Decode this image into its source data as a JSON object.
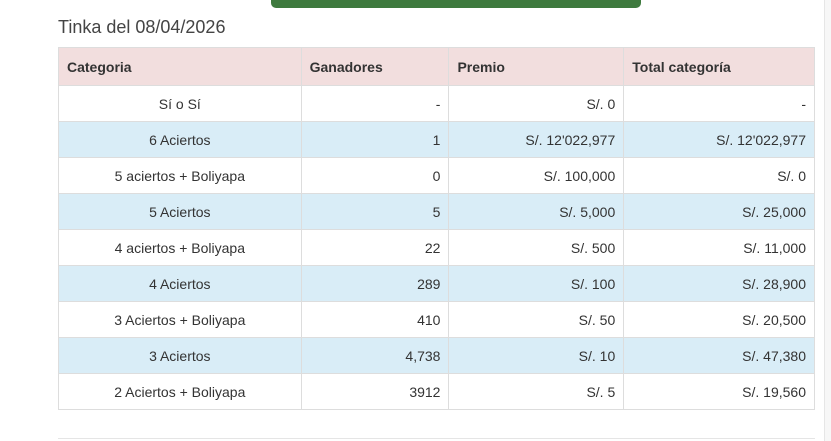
{
  "page_title": "Tinka del 08/04/2026",
  "table": {
    "headers": {
      "category": "Categoria",
      "winners": "Ganadores",
      "prize": "Premio",
      "total": "Total categoría"
    },
    "rows": [
      {
        "category": "Sí o Sí",
        "winners": "-",
        "prize": "S/. 0",
        "total": "-"
      },
      {
        "category": "6 Aciertos",
        "winners": "1",
        "prize": "S/. 12'022,977",
        "total": "S/. 12'022,977"
      },
      {
        "category": "5 aciertos + Boliyapa",
        "winners": "0",
        "prize": "S/. 100,000",
        "total": "S/. 0"
      },
      {
        "category": "5 Aciertos",
        "winners": "5",
        "prize": "S/. 5,000",
        "total": "S/. 25,000"
      },
      {
        "category": "4 aciertos + Boliyapa",
        "winners": "22",
        "prize": "S/. 500",
        "total": "S/. 11,000"
      },
      {
        "category": "4 Aciertos",
        "winners": "289",
        "prize": "S/. 100",
        "total": "S/. 28,900"
      },
      {
        "category": "3 Aciertos + Boliyapa",
        "winners": "410",
        "prize": "S/. 50",
        "total": "S/. 20,500"
      },
      {
        "category": "3 Aciertos",
        "winners": "4,738",
        "prize": "S/. 10",
        "total": "S/. 47,380"
      },
      {
        "category": "2 Aciertos + Boliyapa",
        "winners": "3912",
        "prize": "S/. 5",
        "total": "S/. 19,560"
      }
    ]
  },
  "colors": {
    "header_bg": "#f2dede",
    "striped_row_bg": "#d9edf7",
    "top_bar": "#3e7a3e"
  }
}
